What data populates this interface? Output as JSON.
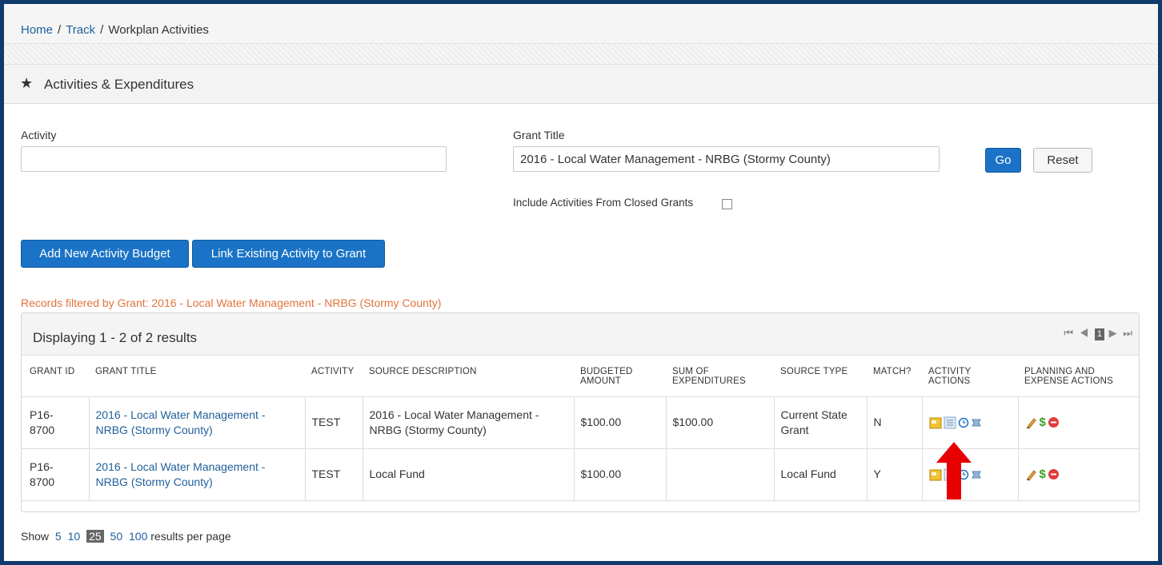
{
  "breadcrumb": {
    "home": "Home",
    "track": "Track",
    "current": "Workplan Activities",
    "sep": "/"
  },
  "section": {
    "title": "Activities & Expenditures",
    "icon": "star-icon"
  },
  "filters": {
    "activity_label": "Activity",
    "activity_value": "",
    "grant_label": "Grant Title",
    "grant_value": "2016 - Local Water Management - NRBG (Stormy County)",
    "go": "Go",
    "reset": "Reset",
    "include_closed": "Include Activities From Closed Grants"
  },
  "actions": {
    "add": "Add New Activity Budget",
    "link": "Link Existing Activity to Grant"
  },
  "filter_note": "Records filtered by Grant: 2016 - Local Water Management - NRBG (Stormy County)",
  "grid": {
    "count": "Displaying 1 - 2 of 2 results",
    "pager": {
      "first": "⏮",
      "prev": "◀",
      "page": "1",
      "next": "▶",
      "last": "⏭"
    },
    "columns": {
      "grant_id": "GRANT ID",
      "grant_title": "GRANT TITLE",
      "activity": "ACTIVITY",
      "source_desc": "SOURCE DESCRIPTION",
      "budgeted_1": "BUDGETED",
      "budgeted_2": "AMOUNT",
      "sum_1": "SUM OF",
      "sum_2": "EXPENDITURES",
      "source_type": "SOURCE TYPE",
      "match": "MATCH?",
      "activity_actions_1": "ACTIVITY",
      "activity_actions_2": "ACTIONS",
      "planning_1": "PLANNING AND",
      "planning_2": "EXPENSE ACTIONS"
    },
    "rows": [
      {
        "grant_id_1": "P16-",
        "grant_id_2": "8700",
        "title_1": "2016 - Local Water Management -",
        "title_2": "NRBG (Stormy County)",
        "activity": "TEST",
        "desc_1": "2016 - Local Water Management -",
        "desc_2": "NRBG (Stormy County)",
        "budgeted": "$100.00",
        "sum": "$100.00",
        "type_1": "Current State",
        "type_2": "Grant",
        "match": "N"
      },
      {
        "grant_id_1": "P16-",
        "grant_id_2": "8700",
        "title_1": "2016 - Local Water Management -",
        "title_2": "NRBG (Stormy County)",
        "activity": "TEST",
        "desc_1": "Local Fund",
        "desc_2": "",
        "budgeted": "$100.00",
        "sum": "",
        "type_1": "Local Fund",
        "type_2": "",
        "match": "Y"
      }
    ]
  },
  "page_size": {
    "show": "Show",
    "opts": [
      "5",
      "10",
      "25",
      "50",
      "100"
    ],
    "suffix": "results per page"
  },
  "colors": {
    "primary": "#1a73c6",
    "link": "#1f5f9a",
    "note": "#e0743c",
    "frame": "#0f3a6b",
    "arrow": "#e60000"
  }
}
